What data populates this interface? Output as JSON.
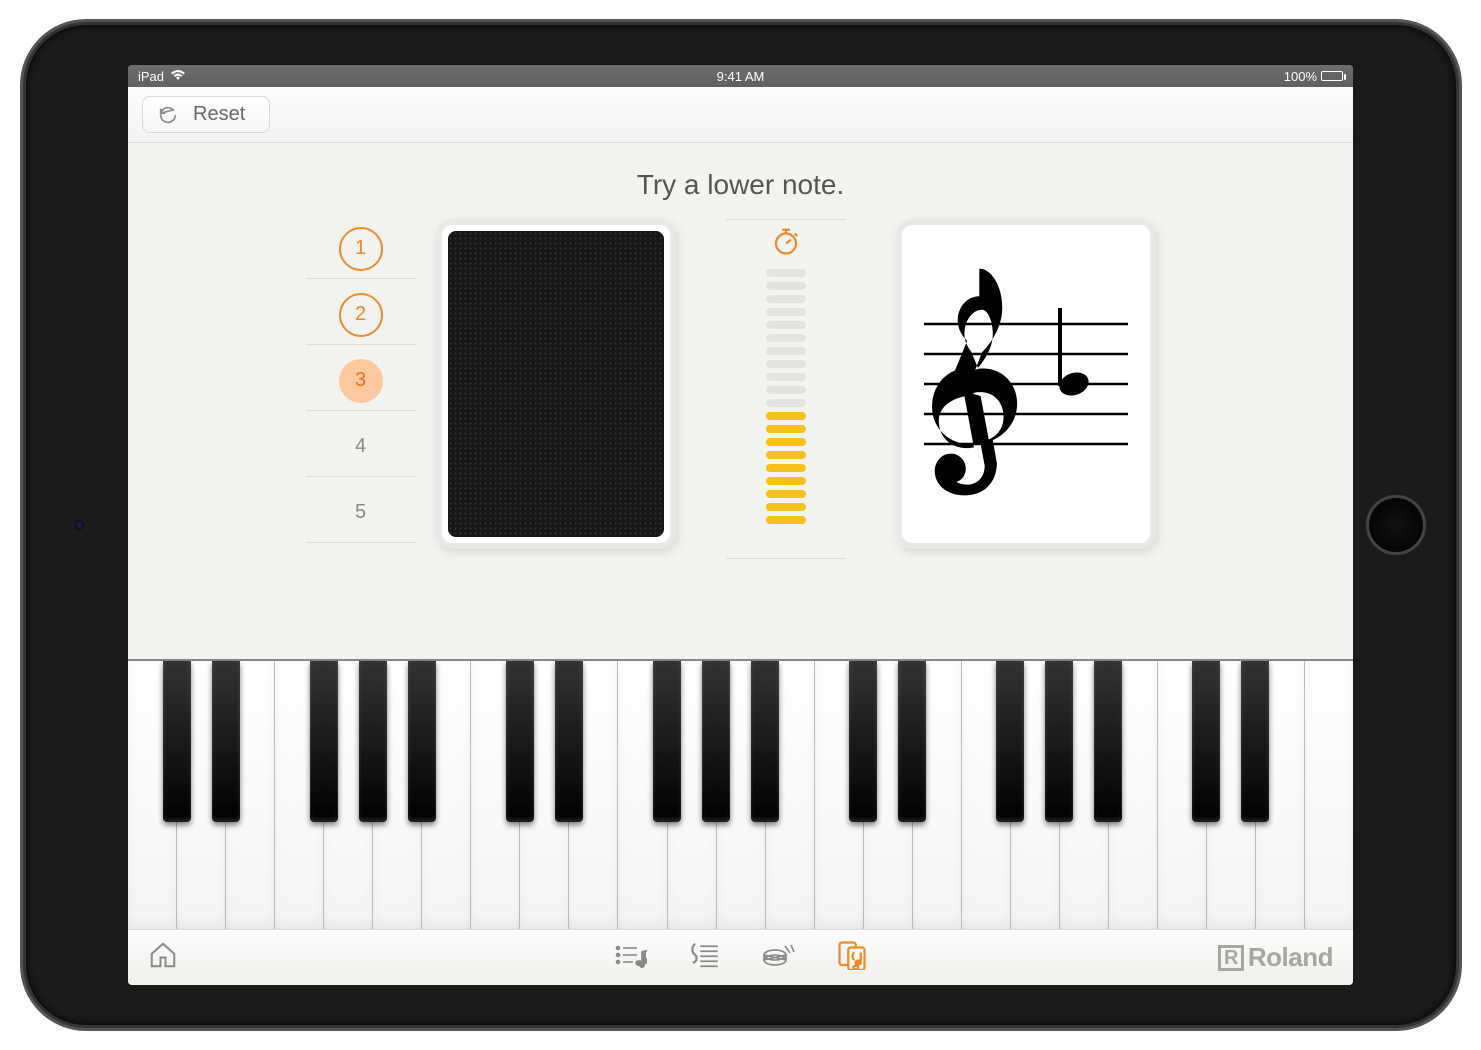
{
  "status": {
    "carrier": "iPad",
    "time": "9:41 AM",
    "battery": "100%"
  },
  "toolbar": {
    "reset_label": "Reset"
  },
  "hint": "Try a lower note.",
  "levels": [
    {
      "n": "1",
      "state": "done"
    },
    {
      "n": "2",
      "state": "done"
    },
    {
      "n": "3",
      "state": "current"
    },
    {
      "n": "4",
      "state": ""
    },
    {
      "n": "5",
      "state": ""
    }
  ],
  "timer": {
    "total": 20,
    "filled": 9
  },
  "note": {
    "clef": "treble",
    "pitch": "B4"
  },
  "piano": {
    "white_keys": 25,
    "octaves_start_index": [
      0,
      7,
      14,
      21
    ]
  },
  "brand": "Roland",
  "colors": {
    "accent": "#f08a2a",
    "gauge": "#f6c21a"
  }
}
